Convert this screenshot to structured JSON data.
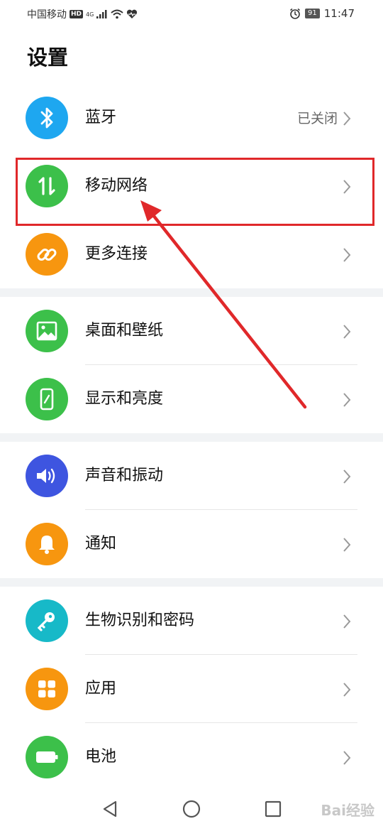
{
  "status_bar": {
    "carrier": "中国移动",
    "hd": "HD",
    "network": "4G",
    "battery": "91",
    "time": "11:47"
  },
  "page": {
    "title": "设置"
  },
  "settings": [
    {
      "label": "蓝牙",
      "value": "已关闭",
      "icon": "bluetooth-icon",
      "color": "#1ea7f0"
    },
    {
      "label": "移动网络",
      "value": "",
      "icon": "mobile-data-icon",
      "color": "#3cc04a"
    },
    {
      "label": "更多连接",
      "value": "",
      "icon": "link-icon",
      "color": "#f7960f"
    },
    {
      "label": "桌面和壁纸",
      "value": "",
      "icon": "wallpaper-icon",
      "color": "#3cc04a"
    },
    {
      "label": "显示和亮度",
      "value": "",
      "icon": "display-icon",
      "color": "#3cc04a"
    },
    {
      "label": "声音和振动",
      "value": "",
      "icon": "sound-icon",
      "color": "#3e55e0"
    },
    {
      "label": "通知",
      "value": "",
      "icon": "bell-icon",
      "color": "#f7960f"
    },
    {
      "label": "生物识别和密码",
      "value": "",
      "icon": "key-icon",
      "color": "#17b9c8"
    },
    {
      "label": "应用",
      "value": "",
      "icon": "apps-icon",
      "color": "#f7960f"
    },
    {
      "label": "电池",
      "value": "",
      "icon": "battery-icon",
      "color": "#3cc04a"
    }
  ],
  "annotation": {
    "color": "#e0282a"
  },
  "watermark": "Bai经验"
}
